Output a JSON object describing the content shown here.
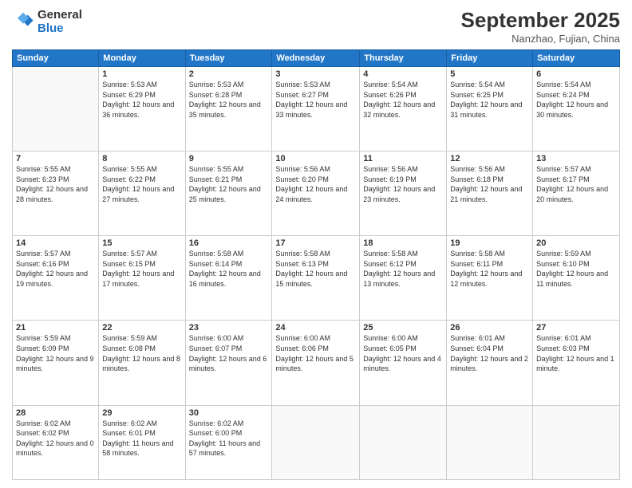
{
  "logo": {
    "line1": "General",
    "line2": "Blue"
  },
  "title": "September 2025",
  "location": "Nanzhao, Fujian, China",
  "weekdays": [
    "Sunday",
    "Monday",
    "Tuesday",
    "Wednesday",
    "Thursday",
    "Friday",
    "Saturday"
  ],
  "weeks": [
    [
      {
        "day": "",
        "sunrise": "",
        "sunset": "",
        "daylight": ""
      },
      {
        "day": "1",
        "sunrise": "Sunrise: 5:53 AM",
        "sunset": "Sunset: 6:29 PM",
        "daylight": "Daylight: 12 hours and 36 minutes."
      },
      {
        "day": "2",
        "sunrise": "Sunrise: 5:53 AM",
        "sunset": "Sunset: 6:28 PM",
        "daylight": "Daylight: 12 hours and 35 minutes."
      },
      {
        "day": "3",
        "sunrise": "Sunrise: 5:53 AM",
        "sunset": "Sunset: 6:27 PM",
        "daylight": "Daylight: 12 hours and 33 minutes."
      },
      {
        "day": "4",
        "sunrise": "Sunrise: 5:54 AM",
        "sunset": "Sunset: 6:26 PM",
        "daylight": "Daylight: 12 hours and 32 minutes."
      },
      {
        "day": "5",
        "sunrise": "Sunrise: 5:54 AM",
        "sunset": "Sunset: 6:25 PM",
        "daylight": "Daylight: 12 hours and 31 minutes."
      },
      {
        "day": "6",
        "sunrise": "Sunrise: 5:54 AM",
        "sunset": "Sunset: 6:24 PM",
        "daylight": "Daylight: 12 hours and 30 minutes."
      }
    ],
    [
      {
        "day": "7",
        "sunrise": "Sunrise: 5:55 AM",
        "sunset": "Sunset: 6:23 PM",
        "daylight": "Daylight: 12 hours and 28 minutes."
      },
      {
        "day": "8",
        "sunrise": "Sunrise: 5:55 AM",
        "sunset": "Sunset: 6:22 PM",
        "daylight": "Daylight: 12 hours and 27 minutes."
      },
      {
        "day": "9",
        "sunrise": "Sunrise: 5:55 AM",
        "sunset": "Sunset: 6:21 PM",
        "daylight": "Daylight: 12 hours and 25 minutes."
      },
      {
        "day": "10",
        "sunrise": "Sunrise: 5:56 AM",
        "sunset": "Sunset: 6:20 PM",
        "daylight": "Daylight: 12 hours and 24 minutes."
      },
      {
        "day": "11",
        "sunrise": "Sunrise: 5:56 AM",
        "sunset": "Sunset: 6:19 PM",
        "daylight": "Daylight: 12 hours and 23 minutes."
      },
      {
        "day": "12",
        "sunrise": "Sunrise: 5:56 AM",
        "sunset": "Sunset: 6:18 PM",
        "daylight": "Daylight: 12 hours and 21 minutes."
      },
      {
        "day": "13",
        "sunrise": "Sunrise: 5:57 AM",
        "sunset": "Sunset: 6:17 PM",
        "daylight": "Daylight: 12 hours and 20 minutes."
      }
    ],
    [
      {
        "day": "14",
        "sunrise": "Sunrise: 5:57 AM",
        "sunset": "Sunset: 6:16 PM",
        "daylight": "Daylight: 12 hours and 19 minutes."
      },
      {
        "day": "15",
        "sunrise": "Sunrise: 5:57 AM",
        "sunset": "Sunset: 6:15 PM",
        "daylight": "Daylight: 12 hours and 17 minutes."
      },
      {
        "day": "16",
        "sunrise": "Sunrise: 5:58 AM",
        "sunset": "Sunset: 6:14 PM",
        "daylight": "Daylight: 12 hours and 16 minutes."
      },
      {
        "day": "17",
        "sunrise": "Sunrise: 5:58 AM",
        "sunset": "Sunset: 6:13 PM",
        "daylight": "Daylight: 12 hours and 15 minutes."
      },
      {
        "day": "18",
        "sunrise": "Sunrise: 5:58 AM",
        "sunset": "Sunset: 6:12 PM",
        "daylight": "Daylight: 12 hours and 13 minutes."
      },
      {
        "day": "19",
        "sunrise": "Sunrise: 5:58 AM",
        "sunset": "Sunset: 6:11 PM",
        "daylight": "Daylight: 12 hours and 12 minutes."
      },
      {
        "day": "20",
        "sunrise": "Sunrise: 5:59 AM",
        "sunset": "Sunset: 6:10 PM",
        "daylight": "Daylight: 12 hours and 11 minutes."
      }
    ],
    [
      {
        "day": "21",
        "sunrise": "Sunrise: 5:59 AM",
        "sunset": "Sunset: 6:09 PM",
        "daylight": "Daylight: 12 hours and 9 minutes."
      },
      {
        "day": "22",
        "sunrise": "Sunrise: 5:59 AM",
        "sunset": "Sunset: 6:08 PM",
        "daylight": "Daylight: 12 hours and 8 minutes."
      },
      {
        "day": "23",
        "sunrise": "Sunrise: 6:00 AM",
        "sunset": "Sunset: 6:07 PM",
        "daylight": "Daylight: 12 hours and 6 minutes."
      },
      {
        "day": "24",
        "sunrise": "Sunrise: 6:00 AM",
        "sunset": "Sunset: 6:06 PM",
        "daylight": "Daylight: 12 hours and 5 minutes."
      },
      {
        "day": "25",
        "sunrise": "Sunrise: 6:00 AM",
        "sunset": "Sunset: 6:05 PM",
        "daylight": "Daylight: 12 hours and 4 minutes."
      },
      {
        "day": "26",
        "sunrise": "Sunrise: 6:01 AM",
        "sunset": "Sunset: 6:04 PM",
        "daylight": "Daylight: 12 hours and 2 minutes."
      },
      {
        "day": "27",
        "sunrise": "Sunrise: 6:01 AM",
        "sunset": "Sunset: 6:03 PM",
        "daylight": "Daylight: 12 hours and 1 minute."
      }
    ],
    [
      {
        "day": "28",
        "sunrise": "Sunrise: 6:02 AM",
        "sunset": "Sunset: 6:02 PM",
        "daylight": "Daylight: 12 hours and 0 minutes."
      },
      {
        "day": "29",
        "sunrise": "Sunrise: 6:02 AM",
        "sunset": "Sunset: 6:01 PM",
        "daylight": "Daylight: 11 hours and 58 minutes."
      },
      {
        "day": "30",
        "sunrise": "Sunrise: 6:02 AM",
        "sunset": "Sunset: 6:00 PM",
        "daylight": "Daylight: 11 hours and 57 minutes."
      },
      {
        "day": "",
        "sunrise": "",
        "sunset": "",
        "daylight": ""
      },
      {
        "day": "",
        "sunrise": "",
        "sunset": "",
        "daylight": ""
      },
      {
        "day": "",
        "sunrise": "",
        "sunset": "",
        "daylight": ""
      },
      {
        "day": "",
        "sunrise": "",
        "sunset": "",
        "daylight": ""
      }
    ]
  ]
}
